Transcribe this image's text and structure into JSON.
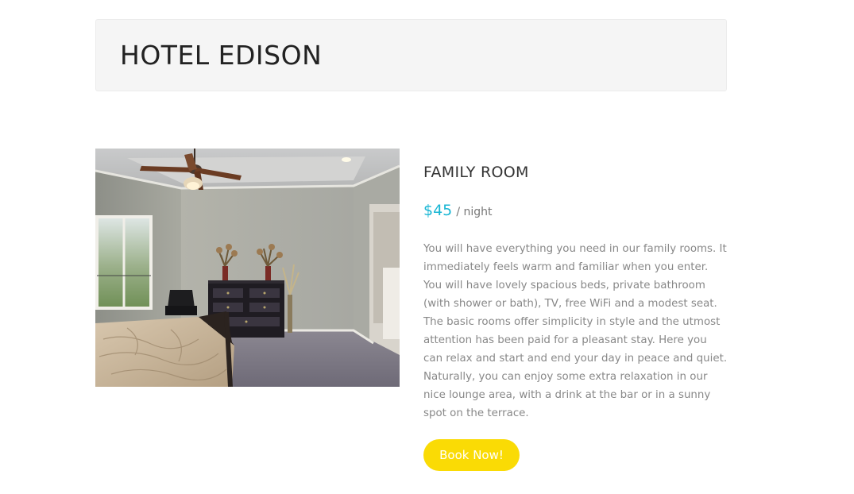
{
  "header": {
    "hotel_name": "HOTEL EDISON"
  },
  "room": {
    "image_icon": "bedroom-photo",
    "title": "FAMILY ROOM",
    "price": "$45",
    "price_unit": "/ night",
    "description": "You will have everything you need in our family rooms. It immediately feels warm and familiar when you enter. You will have lovely spacious beds, private bathroom (with shower or bath), TV, free WiFi and a modest seat. The basic rooms offer simplicity in style and the utmost attention has been paid for a pleasant stay. Here you can relax and start and end your day in peace and quiet. Naturally, you can enjoy some extra relaxation in our nice lounge area, with a drink at the bar or in a sunny spot on the terrace.",
    "book_label": "Book Now!"
  },
  "colors": {
    "accent_price": "#19b6d4",
    "button_yellow": "#fadb05",
    "header_bg": "#f5f5f5"
  }
}
